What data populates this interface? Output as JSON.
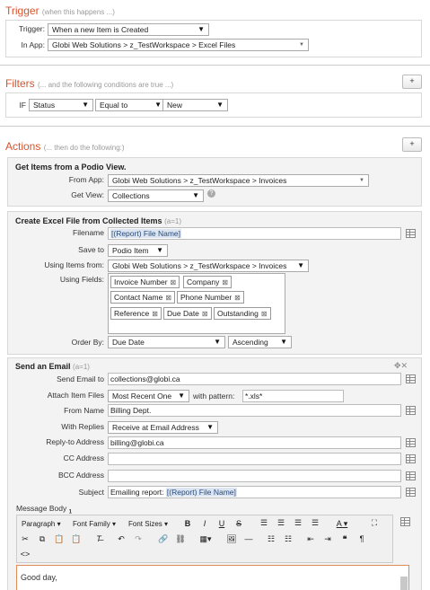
{
  "trigger": {
    "title": "Trigger",
    "hint": "(when this happens ...)",
    "trigger_label": "Trigger:",
    "trigger_value": "When a new Item is Created",
    "app_label": "In App:",
    "app_value": "Globi Web Solutions > z_TestWorkspace > Excel Files"
  },
  "filters": {
    "title": "Filters",
    "hint": "(... and the following conditions are true ...)",
    "add_label": "+",
    "if_label": "IF",
    "field": "Status",
    "operator": "Equal to",
    "value": "New"
  },
  "actions": {
    "title": "Actions",
    "hint": "(... then do the following:)",
    "add_label": "+",
    "get_items": {
      "title": "Get Items from a Podio View.",
      "from_app_label": "From App:",
      "from_app_value": "Globi Web Solutions > z_TestWorkspace > Invoices",
      "get_view_label": "Get View:",
      "get_view_value": "Collections",
      "help_icon": "?"
    },
    "excel": {
      "title": "Create Excel File from Collected Items",
      "id": "(a=1)",
      "filename_label": "Filename",
      "filename_value": "[(Report) File Name]",
      "save_to_label": "Save to",
      "save_to_value": "Podio Item",
      "using_items_label": "Using Items from:",
      "using_items_value": "Globi Web Solutions > z_TestWorkspace > Invoices",
      "using_fields_label": "Using Fields:",
      "fields": [
        "Invoice Number",
        "Company",
        "Contact Name",
        "Phone Number",
        "Reference",
        "Due Date",
        "Outstanding"
      ],
      "order_by_label": "Order By:",
      "order_by_value": "Due Date",
      "order_dir_value": "Ascending"
    },
    "email": {
      "title": "Send an Email",
      "id": "(a=1)",
      "controls": "✥✕",
      "send_to_label": "Send Email to",
      "send_to_value": "collections@globi.ca",
      "attach_label": "Attach Item Files",
      "attach_value": "Most Recent One",
      "pattern_label": "with pattern:",
      "pattern_value": "*.xls*",
      "from_name_label": "From Name",
      "from_name_value": "Billing Dept.",
      "replies_label": "With Replies",
      "replies_value": "Receive at Email Address",
      "reply_to_label": "Reply-to Address",
      "reply_to_value": "billing@globi.ca",
      "cc_label": "CC Address",
      "cc_value": "",
      "bcc_label": "BCC Address",
      "bcc_value": "",
      "subject_label": "Subject",
      "subject_prefix": "Emailing report: ",
      "subject_token": "[(Report) File Name]",
      "body_label": "Message Body",
      "body_marker": "1",
      "toolbar": {
        "paragraph": "Paragraph",
        "font_family": "Font Family",
        "font_sizes": "Font Sizes"
      },
      "body_text": "Good day,"
    }
  }
}
